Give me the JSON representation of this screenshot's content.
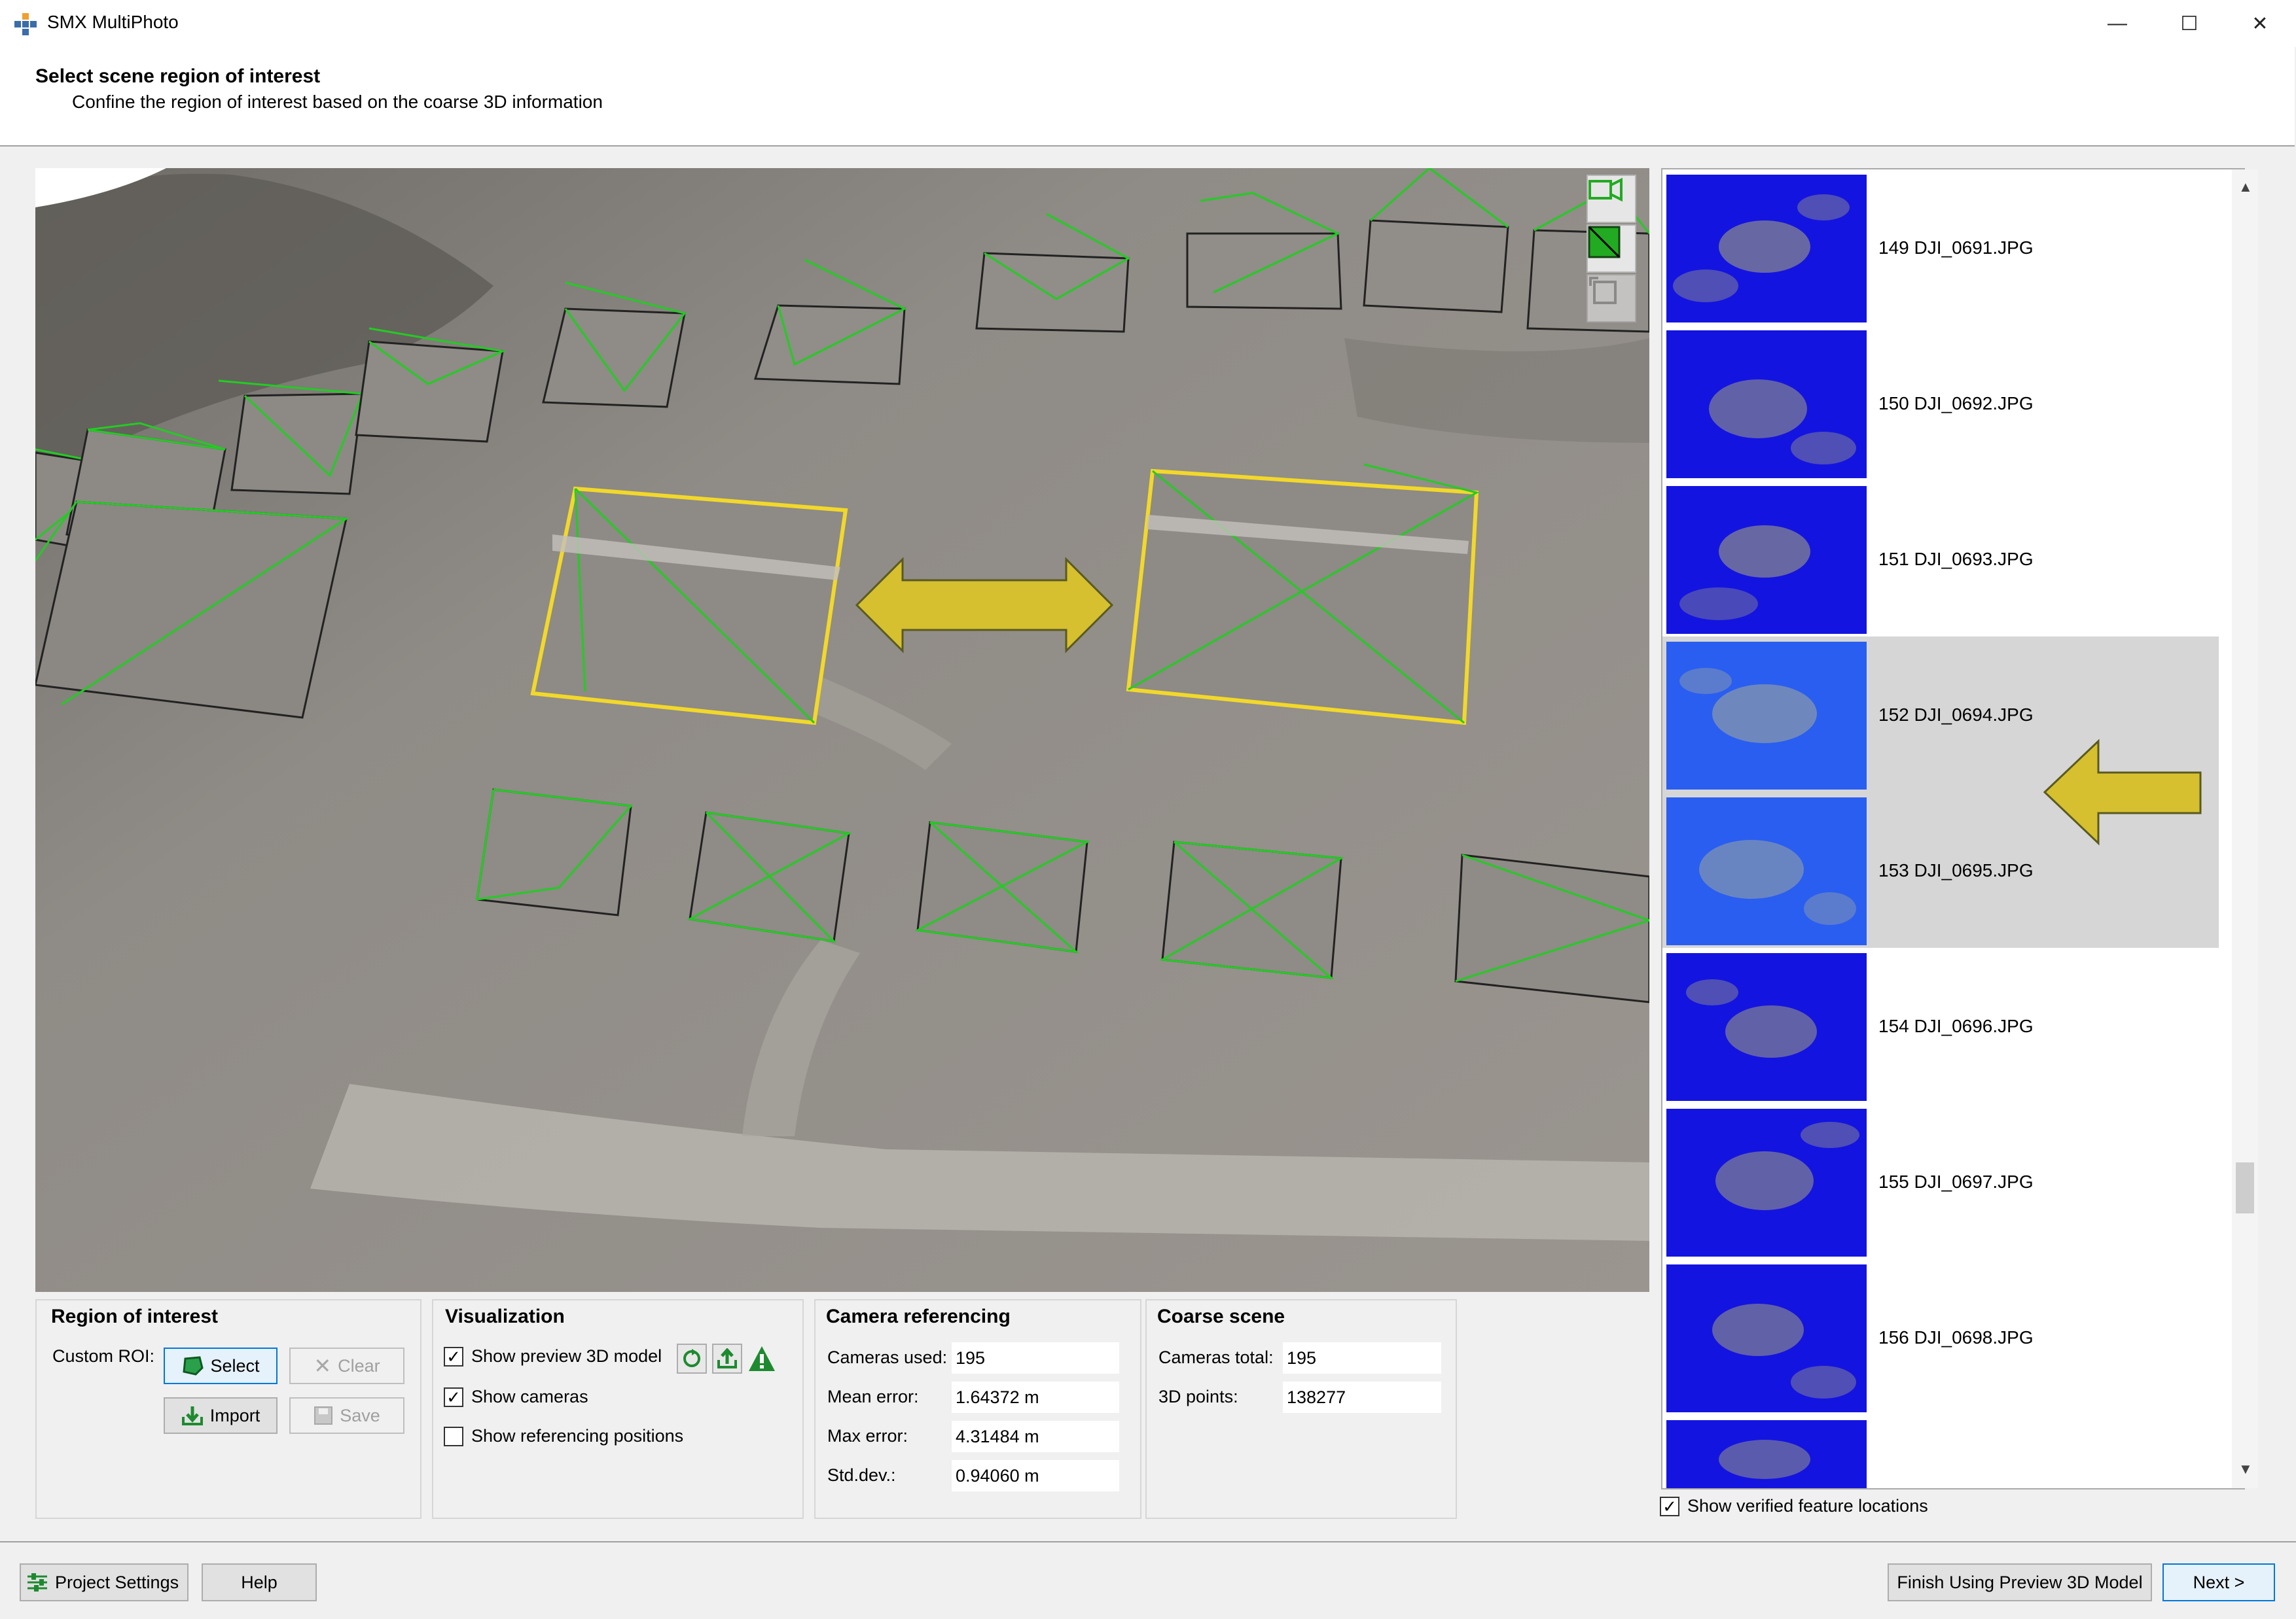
{
  "app": {
    "title": "SMX MultiPhoto"
  },
  "window_buttons": {
    "minimize": "—",
    "maximize": "☐",
    "close": "✕"
  },
  "header": {
    "title": "Select scene region of interest",
    "description": "Confine the region of interest based on the coarse 3D information"
  },
  "viewport": {
    "tools": [
      "camera-view-icon",
      "green-square-icon",
      "crop-icon"
    ],
    "colors": {
      "camera_frame": "#22cc22",
      "highlight_frame": "#f2d82a",
      "arrow": "#d6c030"
    }
  },
  "thumbnails": {
    "items": [
      {
        "label": "149 DJI_0691.JPG",
        "selected": false
      },
      {
        "label": "150 DJI_0692.JPG",
        "selected": false
      },
      {
        "label": "151 DJI_0693.JPG",
        "selected": false
      },
      {
        "label": "152 DJI_0694.JPG",
        "selected": true
      },
      {
        "label": "153 DJI_0695.JPG",
        "selected": true
      },
      {
        "label": "154 DJI_0696.JPG",
        "selected": false
      },
      {
        "label": "155 DJI_0697.JPG",
        "selected": false
      },
      {
        "label": "156 DJI_0698.JPG",
        "selected": false
      }
    ],
    "show_verified_label": "Show verified feature locations",
    "show_verified_checked": true
  },
  "roi": {
    "title": "Region of interest",
    "custom_roi_label": "Custom ROI:",
    "select_label": "Select",
    "clear_label": "Clear",
    "import_label": "Import",
    "save_label": "Save"
  },
  "visualization": {
    "title": "Visualization",
    "show_preview_label": "Show preview 3D model",
    "show_preview_checked": true,
    "show_cameras_label": "Show cameras",
    "show_cameras_checked": true,
    "show_referencing_label": "Show referencing positions",
    "show_referencing_checked": false
  },
  "camera_ref": {
    "title": "Camera referencing",
    "cameras_used_label": "Cameras used:",
    "cameras_used": "195",
    "mean_error_label": "Mean error:",
    "mean_error": "1.64372 m",
    "max_error_label": "Max error:",
    "max_error": "4.31484 m",
    "std_dev_label": "Std.dev.:",
    "std_dev": "0.94060 m"
  },
  "coarse_scene": {
    "title": "Coarse scene",
    "cameras_total_label": "Cameras total:",
    "cameras_total": "195",
    "points_label": "3D points:",
    "points": "138277"
  },
  "footer": {
    "project_settings_label": "Project Settings",
    "help_label": "Help",
    "finish_label": "Finish Using Preview 3D Model",
    "next_label": "Next >"
  }
}
